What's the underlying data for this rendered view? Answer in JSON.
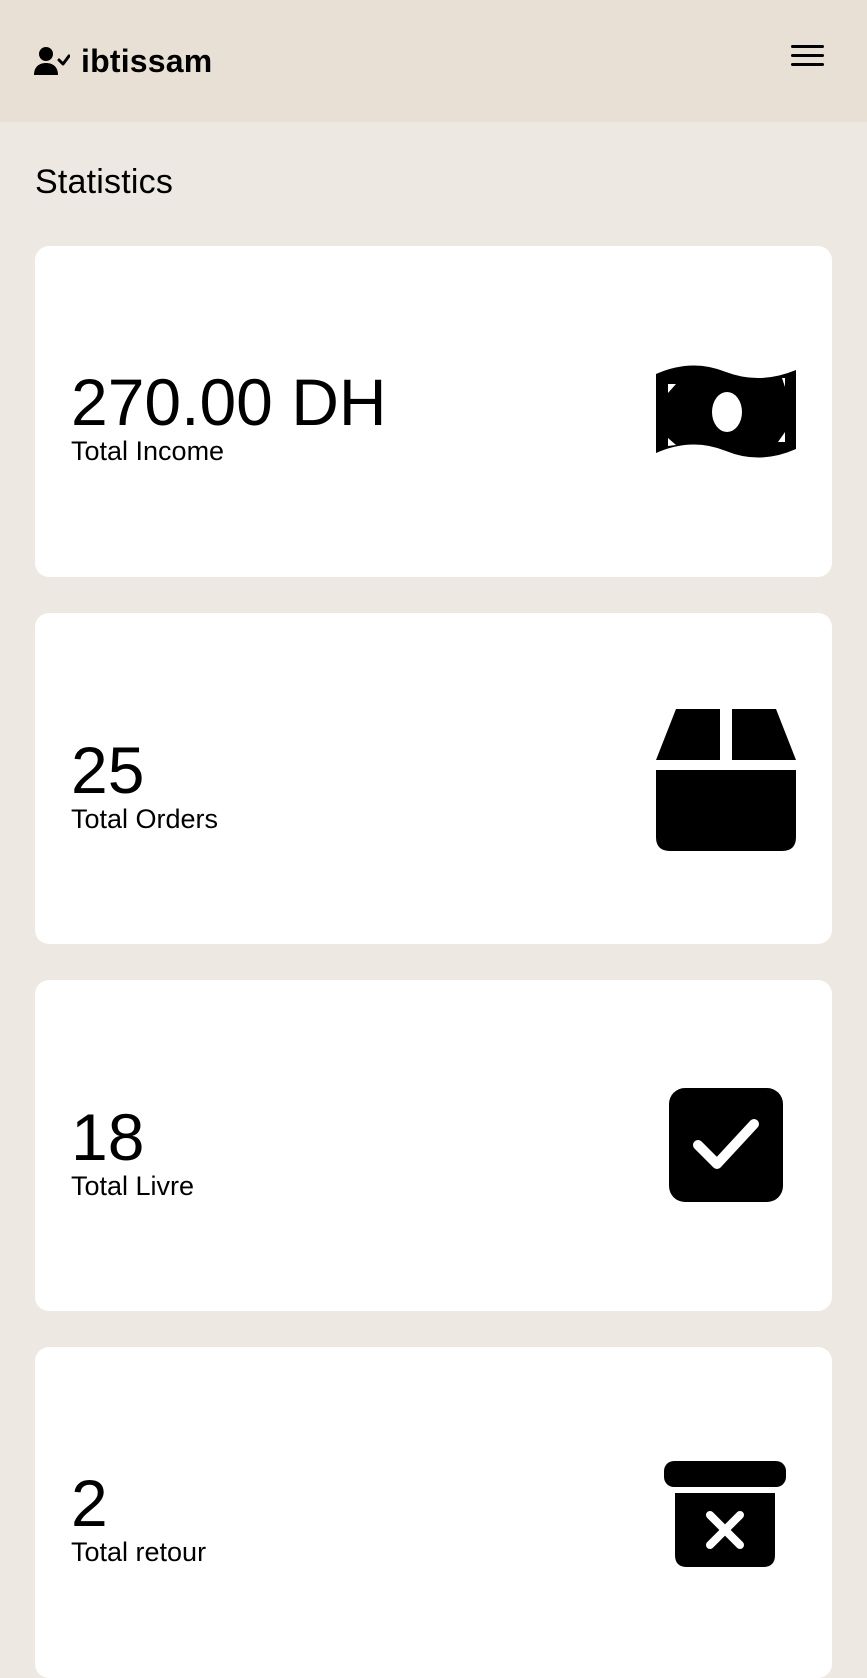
{
  "header": {
    "user_name": "ibtissam",
    "user_icon": "user-check-icon",
    "menu_icon": "hamburger-menu-icon"
  },
  "page": {
    "title": "Statistics"
  },
  "stats": [
    {
      "value": "270.00 DH",
      "label": "Total Income",
      "icon": "money-bill-icon"
    },
    {
      "value": "25",
      "label": "Total Orders",
      "icon": "box-icon"
    },
    {
      "value": "18",
      "label": "Total Livre",
      "icon": "checkbox-icon"
    },
    {
      "value": "2",
      "label": "Total retour",
      "icon": "archive-x-icon"
    }
  ],
  "colors": {
    "header_bg": "#e9e0d5",
    "page_bg": "#ede8e2",
    "card_bg": "#ffffff",
    "text": "#000000"
  }
}
